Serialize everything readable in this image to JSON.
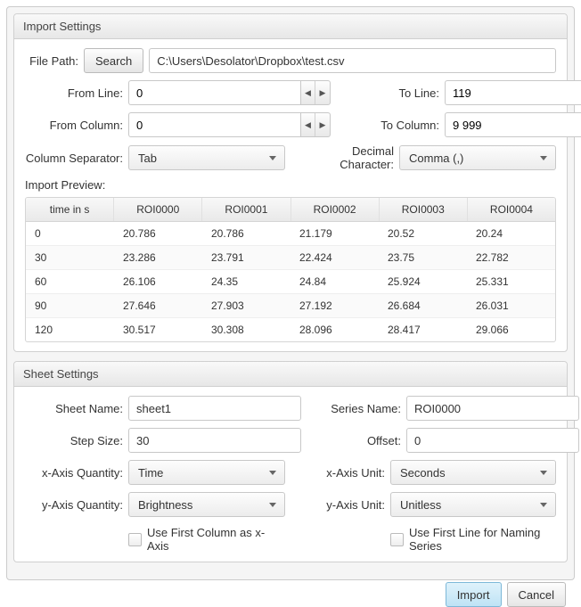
{
  "import": {
    "title": "Import Settings",
    "file_path_label": "File Path:",
    "search_btn": "Search",
    "file_path": "C:\\Users\\Desolator\\Dropbox\\test.csv",
    "from_line_label": "From Line:",
    "from_line": "0",
    "to_line_label": "To Line:",
    "to_line": "119",
    "from_col_label": "From Column:",
    "from_col": "0",
    "to_col_label": "To Column:",
    "to_col": "9 999",
    "col_sep_label": "Column Separator:",
    "col_sep": "Tab",
    "dec_char_label": "Decimal Character:",
    "dec_char": "Comma (,)",
    "preview_label": "Import Preview:",
    "table": {
      "headers": [
        "time in s",
        "ROI0000",
        "ROI0001",
        "ROI0002",
        "ROI0003",
        "ROI0004"
      ],
      "rows": [
        [
          "0",
          "20.786",
          "20.786",
          "21.179",
          "20.52",
          "20.24"
        ],
        [
          "30",
          "23.286",
          "23.791",
          "22.424",
          "23.75",
          "22.782"
        ],
        [
          "60",
          "26.106",
          "24.35",
          "24.84",
          "25.924",
          "25.331"
        ],
        [
          "90",
          "27.646",
          "27.903",
          "27.192",
          "26.684",
          "26.031"
        ],
        [
          "120",
          "30.517",
          "30.308",
          "28.096",
          "28.417",
          "29.066"
        ]
      ]
    }
  },
  "sheet": {
    "title": "Sheet Settings",
    "sheet_name_label": "Sheet Name:",
    "sheet_name": "sheet1",
    "series_name_label": "Series Name:",
    "series_name": "ROI0000",
    "step_size_label": "Step Size:",
    "step_size": "30",
    "offset_label": "Offset:",
    "offset": "0",
    "x_qty_label": "x-Axis Quantity:",
    "x_qty": "Time",
    "x_unit_label": "x-Axis Unit:",
    "x_unit": "Seconds",
    "y_qty_label": "y-Axis Quantity:",
    "y_qty": "Brightness",
    "y_unit_label": "y-Axis Unit:",
    "y_unit": "Unitless",
    "cb1_label": "Use First Column as x-Axis",
    "cb2_label": "Use First Line for Naming Series"
  },
  "buttons": {
    "import": "Import",
    "cancel": "Cancel"
  }
}
